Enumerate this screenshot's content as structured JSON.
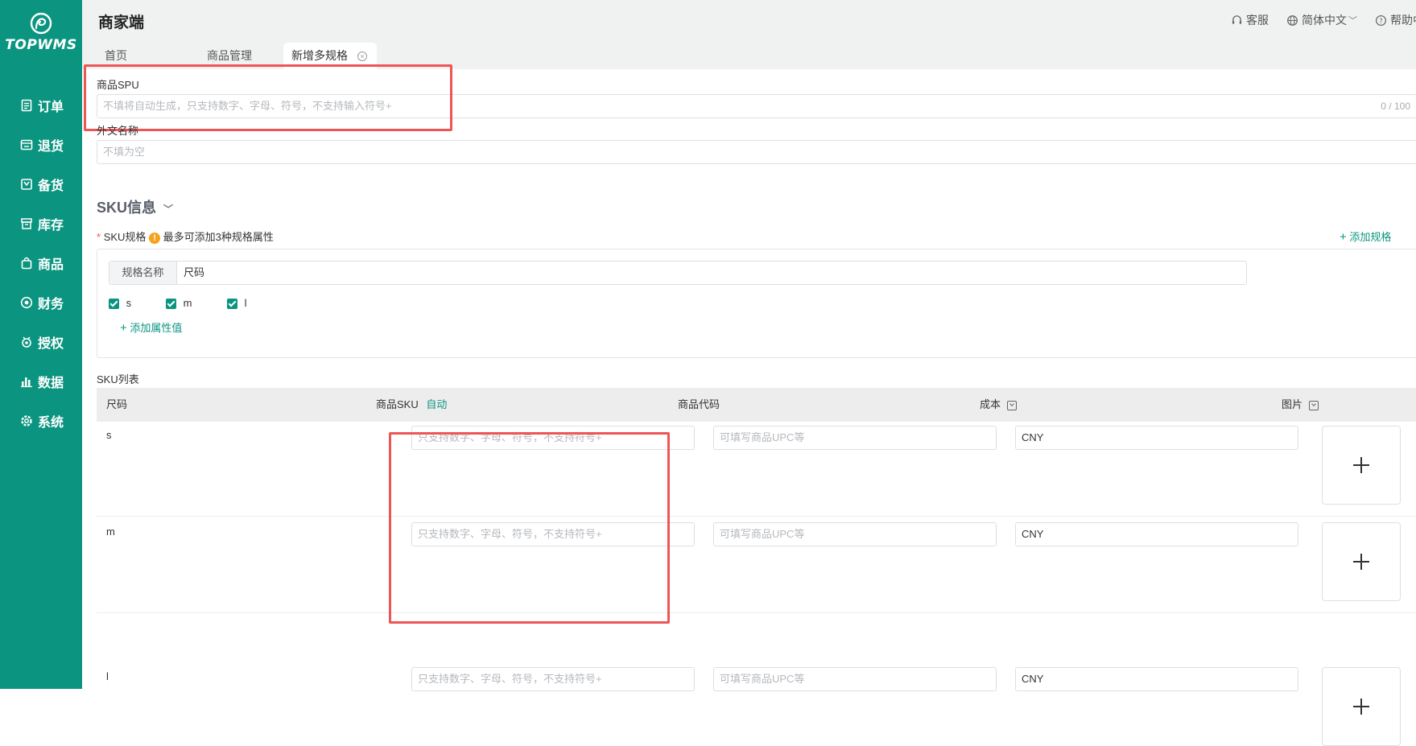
{
  "sidebar": {
    "logo_text": "TOPWMS",
    "items": [
      {
        "label": "订单",
        "icon": "order-icon"
      },
      {
        "label": "退货",
        "icon": "return-icon"
      },
      {
        "label": "备货",
        "icon": "stock-prep-icon"
      },
      {
        "label": "库存",
        "icon": "inventory-icon"
      },
      {
        "label": "商品",
        "icon": "product-icon"
      },
      {
        "label": "财务",
        "icon": "finance-icon"
      },
      {
        "label": "授权",
        "icon": "authorize-icon"
      },
      {
        "label": "数据",
        "icon": "data-chart-icon"
      },
      {
        "label": "系统",
        "icon": "settings-icon"
      }
    ]
  },
  "header": {
    "title": "商家端",
    "service": "客服",
    "language": "简体中文",
    "help": "帮助中"
  },
  "tabs": [
    {
      "label": "首页"
    },
    {
      "label": "商品管理"
    },
    {
      "label": "新增多规格",
      "active": true
    }
  ],
  "form": {
    "spu_label": "商品SPU",
    "spu_placeholder": "不填将自动生成，只支持数字、字母、符号，不支持输入符号+",
    "spu_counter": "0 / 100",
    "foreign_name_label": "外文名称",
    "foreign_name_placeholder": "不填为空"
  },
  "sku_info": {
    "title": "SKU信息",
    "spec_label": "SKU规格",
    "required_mark": "*",
    "spec_hint": "最多可添加3种规格属性",
    "add_spec": "添加规格",
    "spec_name_label": "规格名称",
    "spec_name_value": "尺码",
    "values": [
      {
        "label": "s",
        "checked": true
      },
      {
        "label": "m",
        "checked": true
      },
      {
        "label": "l",
        "checked": true
      }
    ],
    "add_value": "添加属性值"
  },
  "sku_list": {
    "title": "SKU列表",
    "columns": {
      "size": "尺码",
      "sku": "商品SKU",
      "sku_auto": "自动",
      "code": "商品代码",
      "cost": "成本",
      "image": "图片"
    },
    "sku_placeholder": "只支持数字、字母、符号，不支持符号+",
    "code_placeholder": "可填写商品UPC等",
    "rows": [
      {
        "size": "s",
        "cost": "CNY"
      },
      {
        "size": "m",
        "cost": "CNY"
      },
      {
        "size": "l",
        "cost": "CNY"
      }
    ]
  },
  "colors": {
    "brand": "#0b9580",
    "highlight": "#ee5555"
  }
}
